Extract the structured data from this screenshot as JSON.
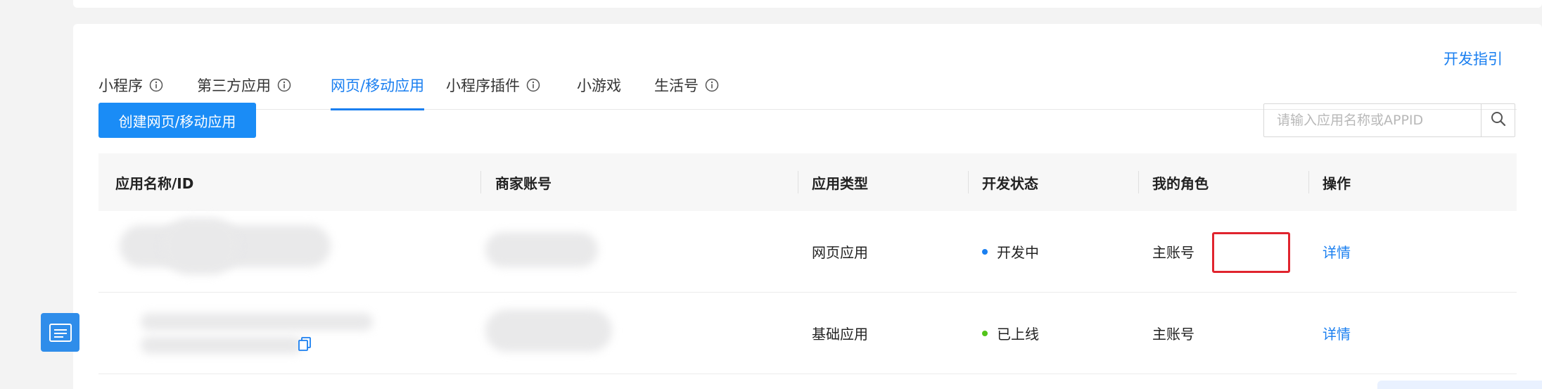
{
  "tabs": [
    {
      "label": "小程序",
      "has_info": true,
      "active": false
    },
    {
      "label": "第三方应用",
      "has_info": true,
      "active": false
    },
    {
      "label": "网页/移动应用",
      "has_info": false,
      "active": true
    },
    {
      "label": "小程序插件",
      "has_info": true,
      "active": false
    },
    {
      "label": "小游戏",
      "has_info": false,
      "active": false
    },
    {
      "label": "生活号",
      "has_info": true,
      "active": false
    }
  ],
  "dev_guide": "开发指引",
  "create_button": "创建网页/移动应用",
  "search": {
    "placeholder": "请输入应用名称或APPID",
    "value": ""
  },
  "table": {
    "columns": [
      "应用名称/ID",
      "商家账号",
      "应用类型",
      "开发状态",
      "我的角色",
      "操作"
    ],
    "rows": [
      {
        "name": "",
        "merchant": "",
        "type": "网页应用",
        "status": "开发中",
        "status_color": "#1a7ff0",
        "role": "主账号",
        "action": "详情"
      },
      {
        "name": "",
        "merchant": "",
        "type": "基础应用",
        "status": "已上线",
        "status_color": "#52c41a",
        "role": "主账号",
        "action": "详情"
      }
    ]
  },
  "icons": {
    "info": "info-icon",
    "search": "search-icon",
    "copy": "copy-icon",
    "app": "app-file-icon"
  }
}
